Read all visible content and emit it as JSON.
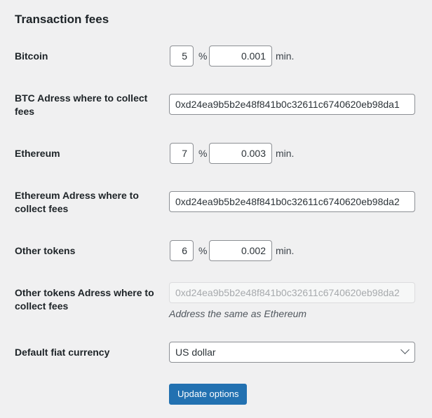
{
  "section_title": "Transaction fees",
  "bitcoin": {
    "label": "Bitcoin",
    "percent": "5",
    "percent_unit": "%",
    "min": "0.001",
    "min_unit": "min."
  },
  "btc_address": {
    "label": "BTC Adress where to collect fees",
    "value": "0xd24ea9b5b2e48f841b0c32611c6740620eb98da1"
  },
  "ethereum": {
    "label": "Ethereum",
    "percent": "7",
    "percent_unit": "%",
    "min": "0.003",
    "min_unit": "min."
  },
  "eth_address": {
    "label": "Ethereum Adress where to collect fees",
    "value": "0xd24ea9b5b2e48f841b0c32611c6740620eb98da2"
  },
  "other_tokens": {
    "label": "Other tokens",
    "percent": "6",
    "percent_unit": "%",
    "min": "0.002",
    "min_unit": "min."
  },
  "other_address": {
    "label": "Other tokens Adress where to collect fees",
    "value": "0xd24ea9b5b2e48f841b0c32611c6740620eb98da2",
    "description": "Address the same as Ethereum"
  },
  "fiat": {
    "label": "Default fiat currency",
    "selected": "US dollar"
  },
  "submit_label": "Update options"
}
